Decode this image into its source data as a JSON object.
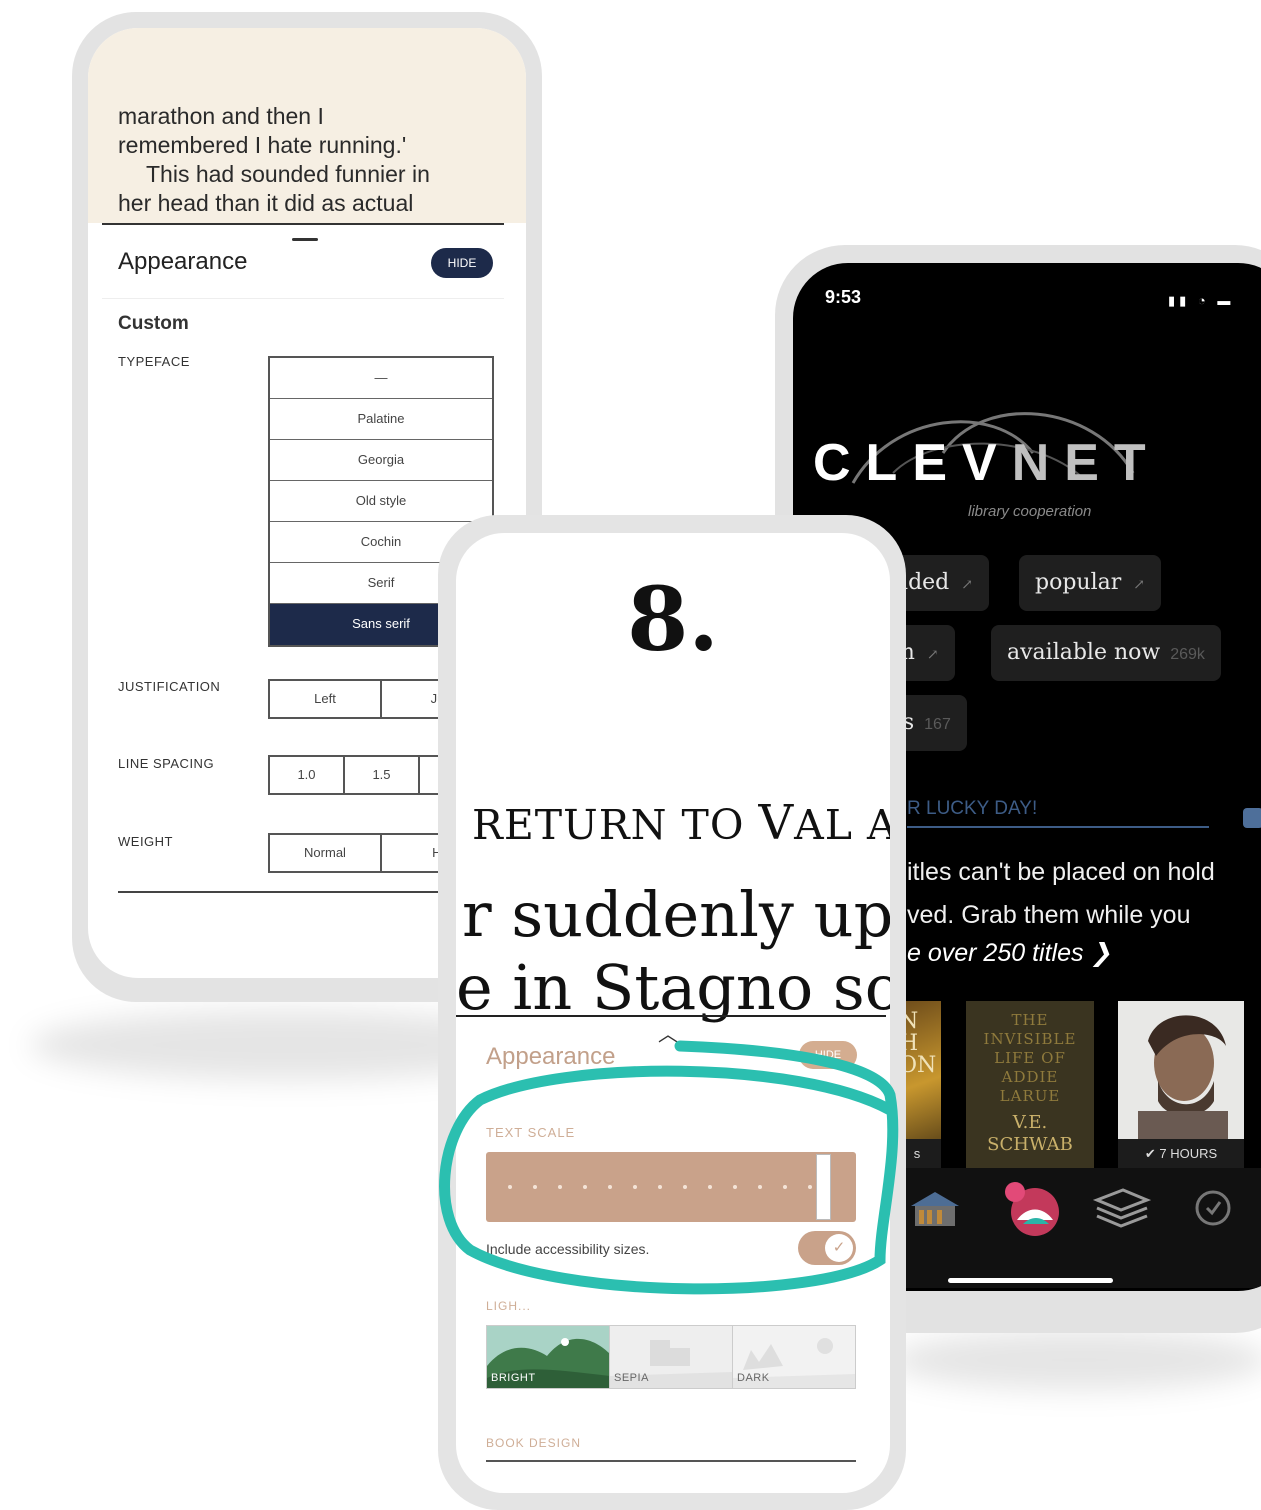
{
  "left_phone": {
    "reader_lines": [
      "marathon and then I",
      "remembered I hate running.'",
      "This had sounded funnier in",
      "her head than it did as actual"
    ],
    "panel_title": "Appearance",
    "hide_label": "HIDE",
    "section": "Custom",
    "typeface_label": "TYPEFACE",
    "typefaces": [
      "—",
      "Palatine",
      "Georgia",
      "Old style",
      "Cochin",
      "Serif",
      "Sans serif"
    ],
    "selected_typeface": "Sans serif",
    "justification_label": "JUSTIFICATION",
    "justification_options": [
      "Left",
      "Justi"
    ],
    "line_spacing_label": "LINE SPACING",
    "line_spacing_options": [
      "1.0",
      "1.5",
      ""
    ],
    "weight_label": "WEIGHT",
    "weight_options": [
      "Normal",
      "Hea"
    ]
  },
  "right_phone": {
    "time": "9:53",
    "status_icons": "▮▮ ◔ ▬",
    "logo_text_a": "CLEV",
    "logo_text_b": "NET",
    "logo_sub": "library cooperation",
    "chips": [
      {
        "label": "dded",
        "count": ""
      },
      {
        "label": "popular",
        "count": ""
      },
      {
        "label": "m",
        "count": ""
      },
      {
        "label": "available now",
        "count": "269k"
      },
      {
        "label": "ts",
        "count": "167"
      }
    ],
    "lucky_title": "R LUCKY DAY!",
    "lucky_lines": [
      "itles can't be placed on hold",
      "ved. Grab them while you"
    ],
    "lucky_link": "e over 250 titles ❯",
    "books": [
      {
        "label": "s",
        "text": "N\nH\nON"
      },
      {
        "label": "",
        "title": "THE INVISIBLE LIFE OF ADDIE LARUE",
        "author": "V.E. SCHWAB"
      },
      {
        "label": "✔ 7 HOURS"
      }
    ],
    "tabs": [
      "library-tab",
      "home-tab",
      "shelf-tab",
      "activity-tab"
    ]
  },
  "center_phone": {
    "step": "8.",
    "book_line_1a": "RETURN TO ",
    "book_line_1b": "V",
    "book_line_1c": "AL A",
    "book_line_2": "r suddenly uptu",
    "book_line_3": "e in Stagno soon",
    "panel_title": "Appearance",
    "hide_label": "HIDE",
    "text_scale_label": "TEXT SCALE",
    "text_scale_steps": 13,
    "text_scale_value": 1.0,
    "accessibility_label": "Include accessibility sizes.",
    "accessibility_on": true,
    "lighting_label": "LIGH...",
    "themes": [
      "BRIGHT",
      "SEPIA",
      "DARK"
    ],
    "selected_theme": "BRIGHT",
    "book_design_label": "BOOK DESIGN",
    "accent_color": "#c9a28a",
    "annotation_color": "#2bbfb0"
  }
}
